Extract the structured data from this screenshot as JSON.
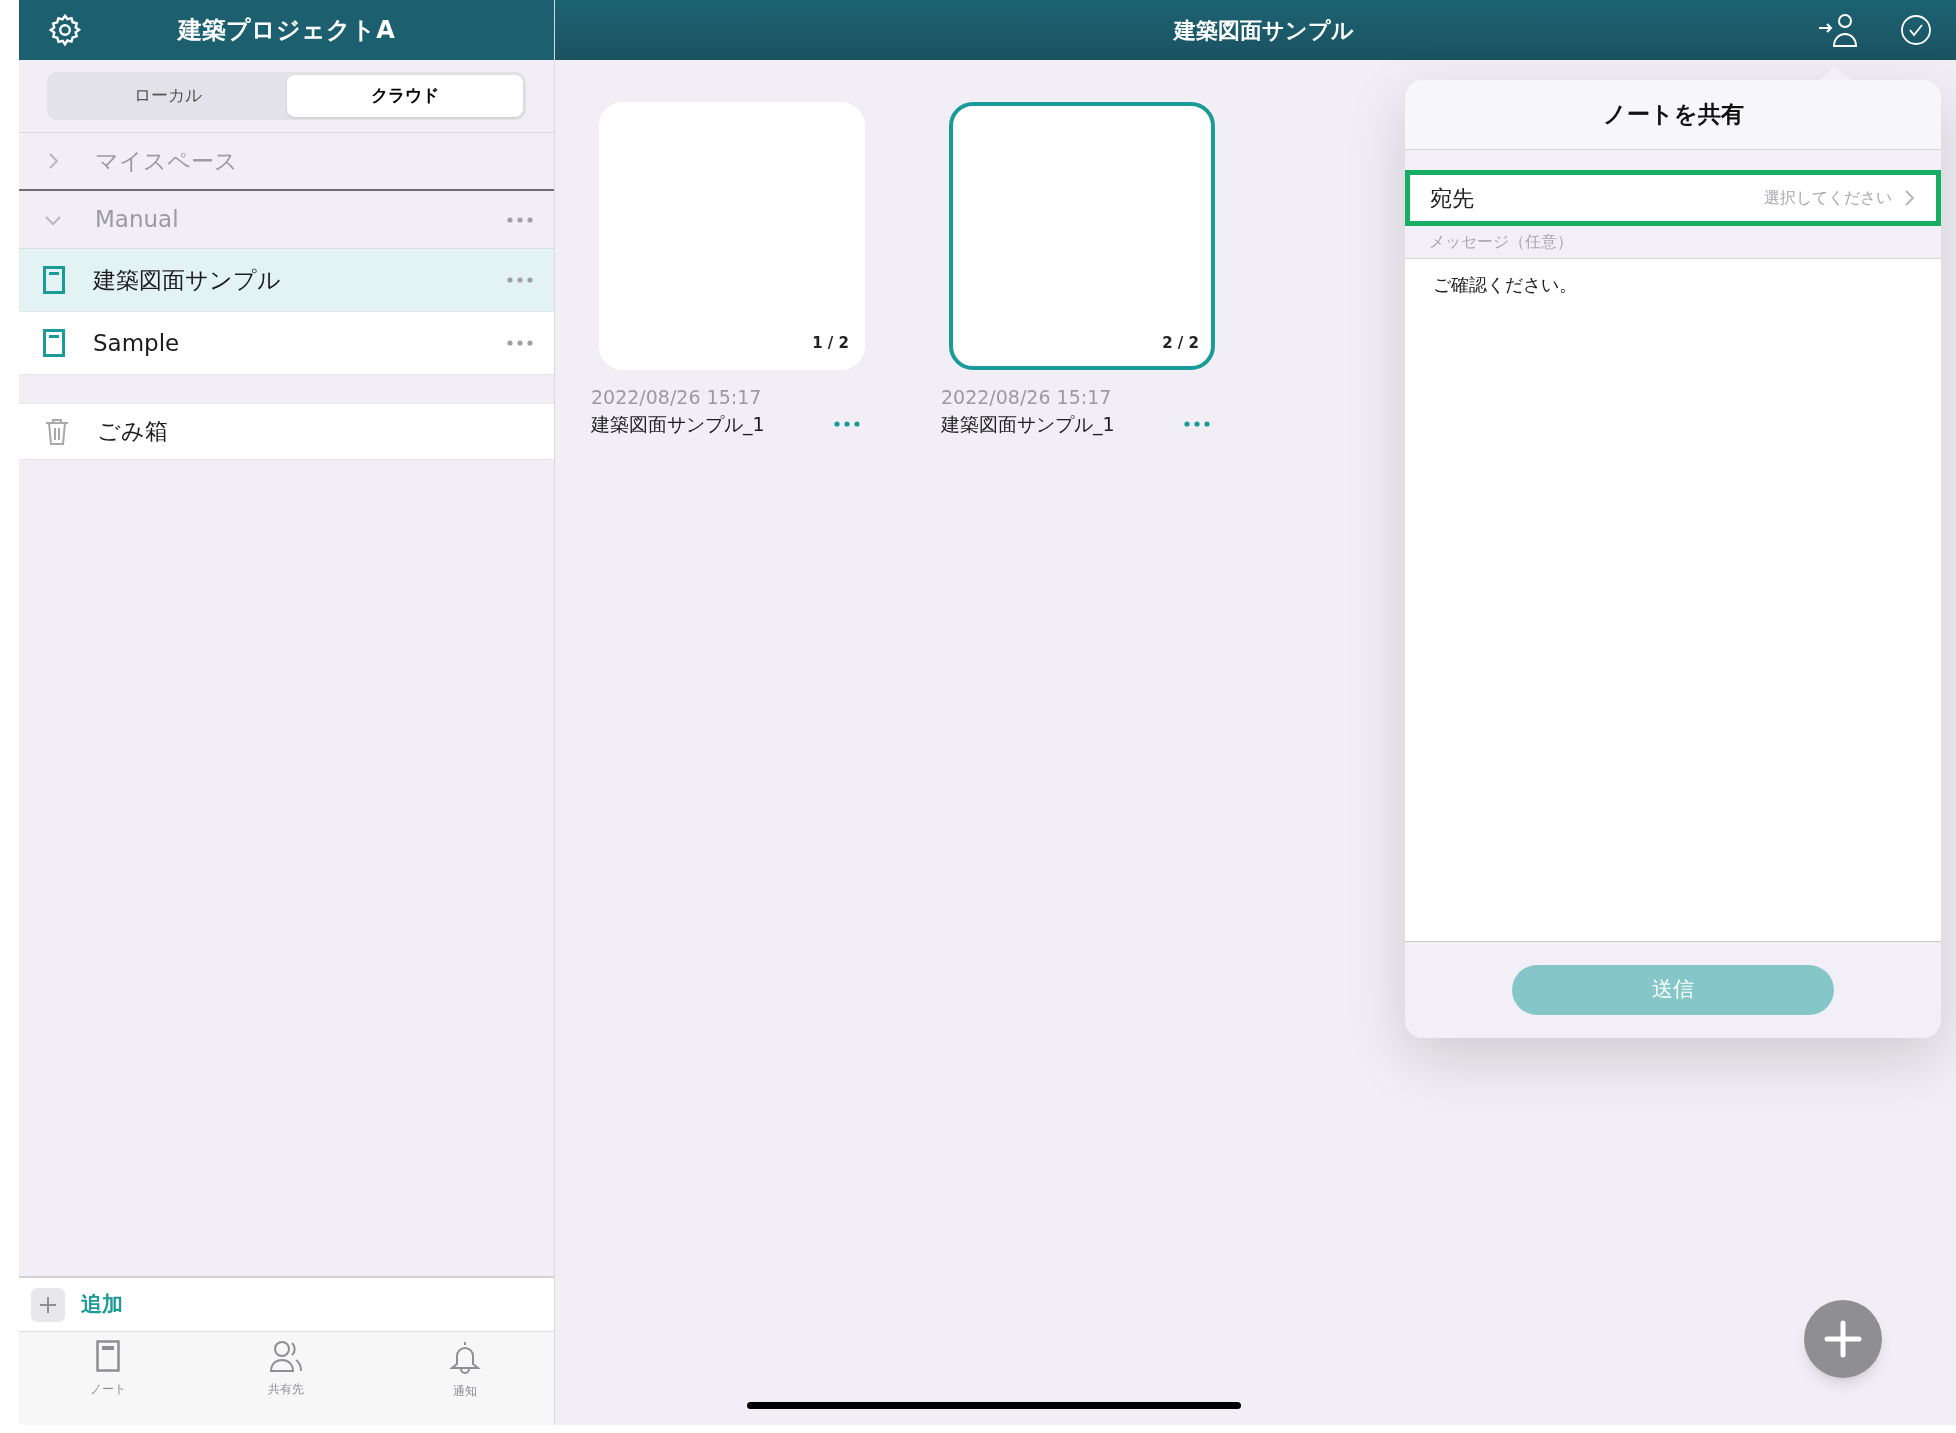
{
  "sidebar": {
    "title": "建築プロジェクトA",
    "segments": [
      {
        "label": "ローカル",
        "selected": false
      },
      {
        "label": "クラウド",
        "selected": true
      }
    ],
    "tree": [
      {
        "label": "マイスペース",
        "expanded": false
      },
      {
        "label": "Manual",
        "expanded": true,
        "children": [
          {
            "label": "建築図面サンプル",
            "selected": true
          },
          {
            "label": "Sample",
            "selected": false
          }
        ]
      }
    ],
    "trash": "ごみ箱",
    "add": "追加",
    "tabs": [
      {
        "kind": "note",
        "label": "ノート"
      },
      {
        "kind": "people",
        "label": "共有先"
      },
      {
        "kind": "bell",
        "label": "通知"
      }
    ]
  },
  "header": {
    "title": "建築図面サンプル"
  },
  "pages": [
    {
      "page_label": "1 / 2",
      "date": "2022/08/26 15:17",
      "name": "建築図面サンプル_1",
      "selected": false
    },
    {
      "page_label": "2 / 2",
      "date": "2022/08/26 15:17",
      "name": "建築図面サンプル_1",
      "selected": true
    }
  ],
  "share_popover": {
    "title": "ノートを共有",
    "recipient": {
      "label": "宛先",
      "placeholder": "選択してください",
      "highlighted": true
    },
    "message_label": "メッセージ（任意）",
    "message": "ご確認ください。",
    "send": {
      "label": "送信",
      "disabled": true
    }
  }
}
